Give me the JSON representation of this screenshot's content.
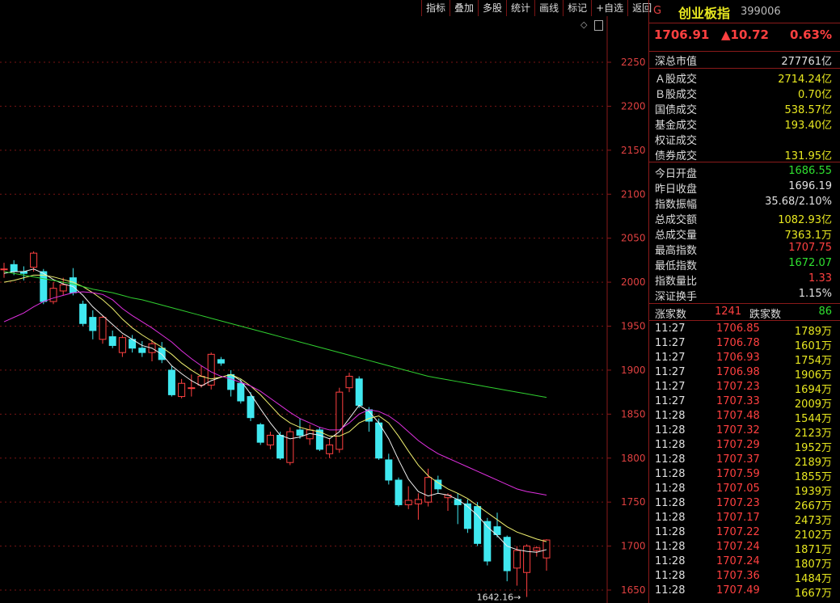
{
  "toolbar": {
    "buttons": [
      "指标",
      "叠加",
      "多股",
      "统计",
      "画线",
      "标记",
      "+自选",
      "返回"
    ]
  },
  "chart": {
    "y_labels": [
      "2250",
      "2200",
      "2150",
      "2100",
      "2050",
      "2000",
      "1950",
      "1900",
      "1850",
      "1800",
      "1750",
      "1700",
      "1650"
    ],
    "min_annotation": "1642.16"
  },
  "chart_data": {
    "type": "candlestick",
    "ylim": [
      1630,
      2270
    ],
    "y_ticks": [
      2250,
      2200,
      2150,
      2100,
      2050,
      2000,
      1950,
      1900,
      1850,
      1800,
      1750,
      1700,
      1650
    ],
    "candles": [
      {
        "o": 2015,
        "c": 2015,
        "h": 2022,
        "l": 2005
      },
      {
        "o": 2020,
        "c": 2012,
        "h": 2025,
        "l": 2008
      },
      {
        "o": 2012,
        "c": 2010,
        "h": 2018,
        "l": 2002
      },
      {
        "o": 2017,
        "c": 2033,
        "h": 2035,
        "l": 2012
      },
      {
        "o": 2012,
        "c": 1978,
        "h": 2015,
        "l": 1975
      },
      {
        "o": 1978,
        "c": 1993,
        "h": 2000,
        "l": 1975
      },
      {
        "o": 1990,
        "c": 1997,
        "h": 2005,
        "l": 1985
      },
      {
        "o": 2005,
        "c": 1988,
        "h": 2016,
        "l": 1985
      },
      {
        "o": 1975,
        "c": 1953,
        "h": 1979,
        "l": 1950
      },
      {
        "o": 1960,
        "c": 1945,
        "h": 1968,
        "l": 1935
      },
      {
        "o": 1935,
        "c": 1960,
        "h": 1962,
        "l": 1930
      },
      {
        "o": 1938,
        "c": 1928,
        "h": 1945,
        "l": 1925
      },
      {
        "o": 1920,
        "c": 1937,
        "h": 1940,
        "l": 1915
      },
      {
        "o": 1935,
        "c": 1925,
        "h": 1940,
        "l": 1920
      },
      {
        "o": 1925,
        "c": 1920,
        "h": 1933,
        "l": 1915
      },
      {
        "o": 1920,
        "c": 1930,
        "h": 1935,
        "l": 1910
      },
      {
        "o": 1925,
        "c": 1912,
        "h": 1932,
        "l": 1908
      },
      {
        "o": 1900,
        "c": 1872,
        "h": 1905,
        "l": 1870
      },
      {
        "o": 1870,
        "c": 1885,
        "h": 1890,
        "l": 1868
      },
      {
        "o": 1880,
        "c": 1880,
        "h": 1895,
        "l": 1870
      },
      {
        "o": 1883,
        "c": 1893,
        "h": 1905,
        "l": 1880
      },
      {
        "o": 1883,
        "c": 1918,
        "h": 1920,
        "l": 1878
      },
      {
        "o": 1912,
        "c": 1908,
        "h": 1915,
        "l": 1905
      },
      {
        "o": 1895,
        "c": 1878,
        "h": 1900,
        "l": 1870
      },
      {
        "o": 1885,
        "c": 1865,
        "h": 1890,
        "l": 1862
      },
      {
        "o": 1870,
        "c": 1846,
        "h": 1875,
        "l": 1842
      },
      {
        "o": 1838,
        "c": 1818,
        "h": 1840,
        "l": 1815
      },
      {
        "o": 1815,
        "c": 1826,
        "h": 1830,
        "l": 1810
      },
      {
        "o": 1826,
        "c": 1800,
        "h": 1830,
        "l": 1798
      },
      {
        "o": 1795,
        "c": 1830,
        "h": 1835,
        "l": 1792
      },
      {
        "o": 1832,
        "c": 1826,
        "h": 1845,
        "l": 1822
      },
      {
        "o": 1822,
        "c": 1832,
        "h": 1838,
        "l": 1815
      },
      {
        "o": 1832,
        "c": 1810,
        "h": 1835,
        "l": 1808
      },
      {
        "o": 1805,
        "c": 1815,
        "h": 1822,
        "l": 1800
      },
      {
        "o": 1810,
        "c": 1875,
        "h": 1880,
        "l": 1806
      },
      {
        "o": 1880,
        "c": 1893,
        "h": 1897,
        "l": 1875
      },
      {
        "o": 1890,
        "c": 1860,
        "h": 1893,
        "l": 1857
      },
      {
        "o": 1855,
        "c": 1842,
        "h": 1858,
        "l": 1830
      },
      {
        "o": 1840,
        "c": 1800,
        "h": 1845,
        "l": 1798
      },
      {
        "o": 1798,
        "c": 1775,
        "h": 1805,
        "l": 1770
      },
      {
        "o": 1775,
        "c": 1747,
        "h": 1778,
        "l": 1745
      },
      {
        "o": 1747,
        "c": 1752,
        "h": 1768,
        "l": 1742
      },
      {
        "o": 1748,
        "c": 1753,
        "h": 1760,
        "l": 1730
      },
      {
        "o": 1750,
        "c": 1778,
        "h": 1788,
        "l": 1745
      },
      {
        "o": 1775,
        "c": 1765,
        "h": 1780,
        "l": 1760
      },
      {
        "o": 1755,
        "c": 1758,
        "h": 1760,
        "l": 1740
      },
      {
        "o": 1753,
        "c": 1747,
        "h": 1760,
        "l": 1725
      },
      {
        "o": 1748,
        "c": 1720,
        "h": 1753,
        "l": 1715
      },
      {
        "o": 1745,
        "c": 1703,
        "h": 1750,
        "l": 1700
      },
      {
        "o": 1728,
        "c": 1683,
        "h": 1732,
        "l": 1678
      },
      {
        "o": 1722,
        "c": 1713,
        "h": 1738,
        "l": 1710
      },
      {
        "o": 1710,
        "c": 1672,
        "h": 1712,
        "l": 1660
      },
      {
        "o": 1675,
        "c": 1695,
        "h": 1700,
        "l": 1655
      },
      {
        "o": 1670,
        "c": 1700,
        "h": 1702,
        "l": 1642.16
      },
      {
        "o": 1695,
        "c": 1698,
        "h": 1700,
        "l": 1688
      },
      {
        "o": 1686.55,
        "c": 1706.91,
        "h": 1707.75,
        "l": 1672.07
      }
    ],
    "ma_lines": [
      {
        "color": "#f0f0f0",
        "values": [
          2010,
          2012,
          2012,
          2015,
          2010,
          2003,
          1998,
          1995,
          1985,
          1972,
          1962,
          1952,
          1942,
          1935,
          1928,
          1925,
          1918,
          1905,
          1896,
          1888,
          1882,
          1888,
          1892,
          1895,
          1888,
          1873,
          1856,
          1840,
          1826,
          1822,
          1824,
          1828,
          1826,
          1822,
          1830,
          1845,
          1860,
          1853,
          1840,
          1822,
          1798,
          1776,
          1762,
          1757,
          1760,
          1758,
          1753,
          1745,
          1735,
          1722,
          1712,
          1700,
          1696,
          1694,
          1693,
          1696
        ]
      },
      {
        "color": "#f0f070",
        "values": [
          2000,
          2002,
          2005,
          2008,
          2008,
          2006,
          2003,
          2000,
          1995,
          1988,
          1980,
          1970,
          1958,
          1948,
          1940,
          1933,
          1926,
          1918,
          1908,
          1900,
          1893,
          1890,
          1892,
          1895,
          1890,
          1882,
          1872,
          1860,
          1848,
          1840,
          1835,
          1832,
          1830,
          1825,
          1825,
          1830,
          1840,
          1845,
          1848,
          1840,
          1825,
          1808,
          1792,
          1780,
          1772,
          1765,
          1760,
          1754,
          1746,
          1738,
          1730,
          1722,
          1716,
          1712,
          1708,
          1705
        ]
      },
      {
        "color": "#e030e0",
        "values": [
          1955,
          1960,
          1965,
          1972,
          1978,
          1982,
          1985,
          1988,
          1989,
          1988,
          1986,
          1980,
          1970,
          1962,
          1955,
          1948,
          1940,
          1932,
          1922,
          1913,
          1905,
          1898,
          1893,
          1890,
          1886,
          1882,
          1876,
          1868,
          1860,
          1852,
          1845,
          1840,
          1835,
          1832,
          1832,
          1840,
          1850,
          1855,
          1853,
          1848,
          1840,
          1830,
          1820,
          1812,
          1805,
          1800,
          1795,
          1790,
          1785,
          1780,
          1775,
          1770,
          1765,
          1762,
          1760,
          1758
        ]
      },
      {
        "color": "#30d030",
        "values": [
          2012,
          2010,
          2008,
          2006,
          2004,
          2002,
          2000,
          1998,
          1995,
          1992,
          1990,
          1988,
          1985,
          1982,
          1980,
          1977,
          1974,
          1971,
          1968,
          1965,
          1962,
          1959,
          1956,
          1953,
          1950,
          1947,
          1944,
          1941,
          1938,
          1935,
          1932,
          1929,
          1926,
          1923,
          1920,
          1917,
          1914,
          1911,
          1908,
          1905,
          1902,
          1899,
          1896,
          1893,
          1891,
          1889,
          1887,
          1885,
          1883,
          1881,
          1879,
          1877,
          1875,
          1873,
          1871,
          1869
        ]
      }
    ]
  },
  "stock": {
    "market_tag": "G",
    "name": "创业板指",
    "code": "399006",
    "price": "1706.91",
    "change": "▲10.72",
    "change_pct": "0.63%"
  },
  "stats": [
    {
      "label": "深总市值",
      "value": "277761亿",
      "color": "w"
    },
    {
      "label": "Ａ股成交",
      "value": "2714.24亿",
      "color": "y"
    },
    {
      "label": "Ｂ股成交",
      "value": "0.70亿",
      "color": "y"
    },
    {
      "label": "国债成交",
      "value": "538.57亿",
      "color": "y"
    },
    {
      "label": "基金成交",
      "value": "193.40亿",
      "color": "y"
    },
    {
      "label": "权证成交",
      "value": "",
      "color": "y"
    },
    {
      "label": "债券成交",
      "value": "131.95亿",
      "color": "y"
    },
    {
      "label": "今日开盘",
      "value": "1686.55",
      "color": "g2"
    },
    {
      "label": "昨日收盘",
      "value": "1696.19",
      "color": "w"
    },
    {
      "label": "指数振幅",
      "value": "35.68/2.10%",
      "color": "w"
    },
    {
      "label": "总成交额",
      "value": "1082.93亿",
      "color": "y"
    },
    {
      "label": "总成交量",
      "value": "7363.1万",
      "color": "y"
    },
    {
      "label": "最高指数",
      "value": "1707.75",
      "color": "rd"
    },
    {
      "label": "最低指数",
      "value": "1672.07",
      "color": "g2"
    },
    {
      "label": "指数量比",
      "value": "1.33",
      "color": "rd"
    },
    {
      "label": "深证换手",
      "value": "1.15%",
      "color": "w"
    }
  ],
  "counts": {
    "up_label": "涨家数",
    "up_value": "1241",
    "down_label": "跌家数",
    "down_value": "86"
  },
  "ticks": [
    {
      "time": "11:27",
      "price": "1706.85",
      "vol": "1789万"
    },
    {
      "time": "11:27",
      "price": "1706.78",
      "vol": "1601万"
    },
    {
      "time": "11:27",
      "price": "1706.93",
      "vol": "1754万"
    },
    {
      "time": "11:27",
      "price": "1706.98",
      "vol": "1906万"
    },
    {
      "time": "11:27",
      "price": "1707.23",
      "vol": "1694万"
    },
    {
      "time": "11:27",
      "price": "1707.33",
      "vol": "2009万"
    },
    {
      "time": "11:28",
      "price": "1707.48",
      "vol": "1544万"
    },
    {
      "time": "11:28",
      "price": "1707.32",
      "vol": "2123万"
    },
    {
      "time": "11:28",
      "price": "1707.29",
      "vol": "1952万"
    },
    {
      "time": "11:28",
      "price": "1707.37",
      "vol": "2189万"
    },
    {
      "time": "11:28",
      "price": "1707.59",
      "vol": "1855万"
    },
    {
      "time": "11:28",
      "price": "1707.05",
      "vol": "1939万"
    },
    {
      "time": "11:28",
      "price": "1707.23",
      "vol": "2667万"
    },
    {
      "time": "11:28",
      "price": "1707.17",
      "vol": "2473万"
    },
    {
      "time": "11:28",
      "price": "1707.22",
      "vol": "2102万"
    },
    {
      "time": "11:28",
      "price": "1707.24",
      "vol": "1871万"
    },
    {
      "time": "11:28",
      "price": "1707.24",
      "vol": "1807万"
    },
    {
      "time": "11:28",
      "price": "1707.36",
      "vol": "1484万"
    },
    {
      "time": "11:28",
      "price": "1707.49",
      "vol": "1667万"
    }
  ]
}
